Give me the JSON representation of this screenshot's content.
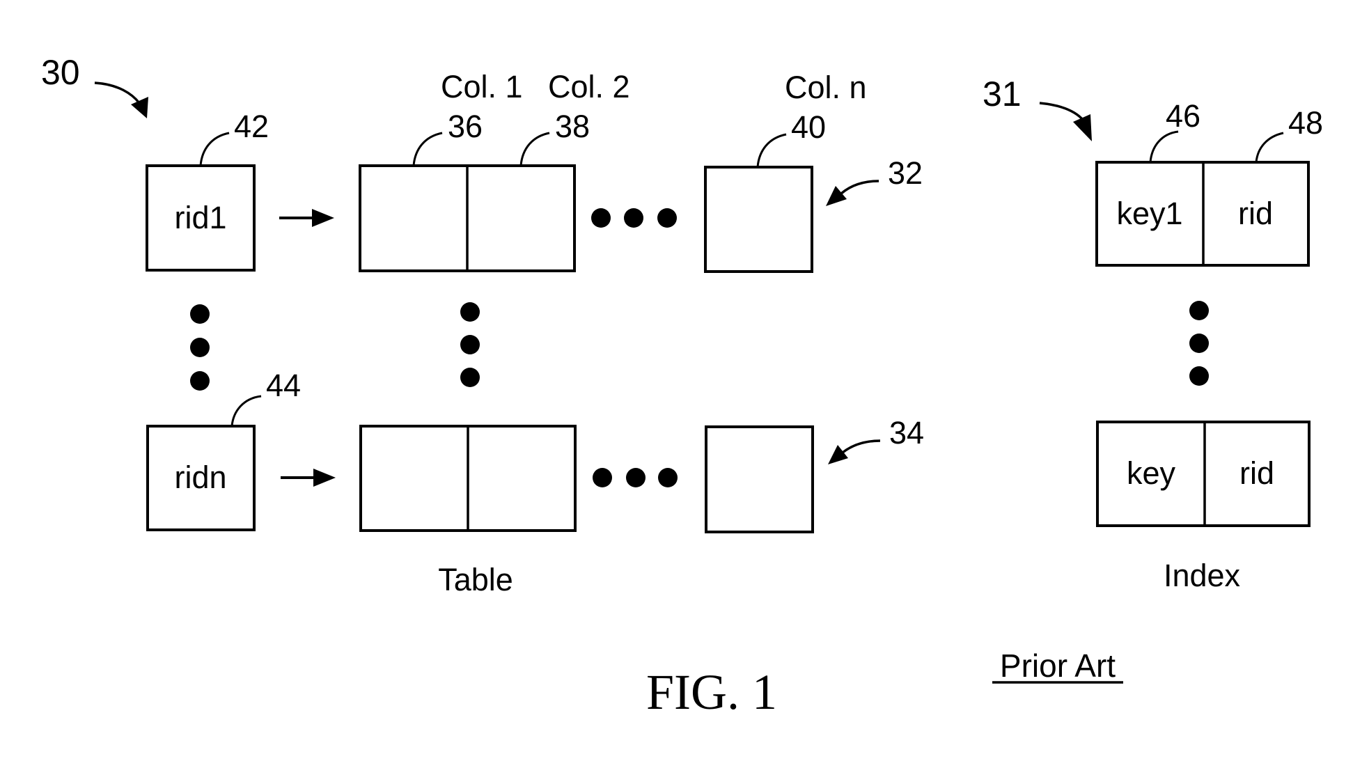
{
  "figure": {
    "title": "FIG. 1",
    "note": "Prior Art"
  },
  "table_section": {
    "ref_number": "30",
    "caption": "Table",
    "column_labels": [
      "Col. 1",
      "Col. 2",
      "Col. n"
    ],
    "column_refs": [
      "36",
      "38",
      "40"
    ],
    "rows": [
      {
        "rid_label": "rid1",
        "rid_ref": "42",
        "row_ref": "32"
      },
      {
        "rid_label": "ridn",
        "rid_ref": "44",
        "row_ref": "34"
      }
    ]
  },
  "index_section": {
    "ref_number": "31",
    "caption": "Index",
    "field_refs": [
      "46",
      "48"
    ],
    "rows": [
      {
        "key": "key1",
        "rid": "rid"
      },
      {
        "key": "key",
        "rid": "rid"
      }
    ]
  }
}
